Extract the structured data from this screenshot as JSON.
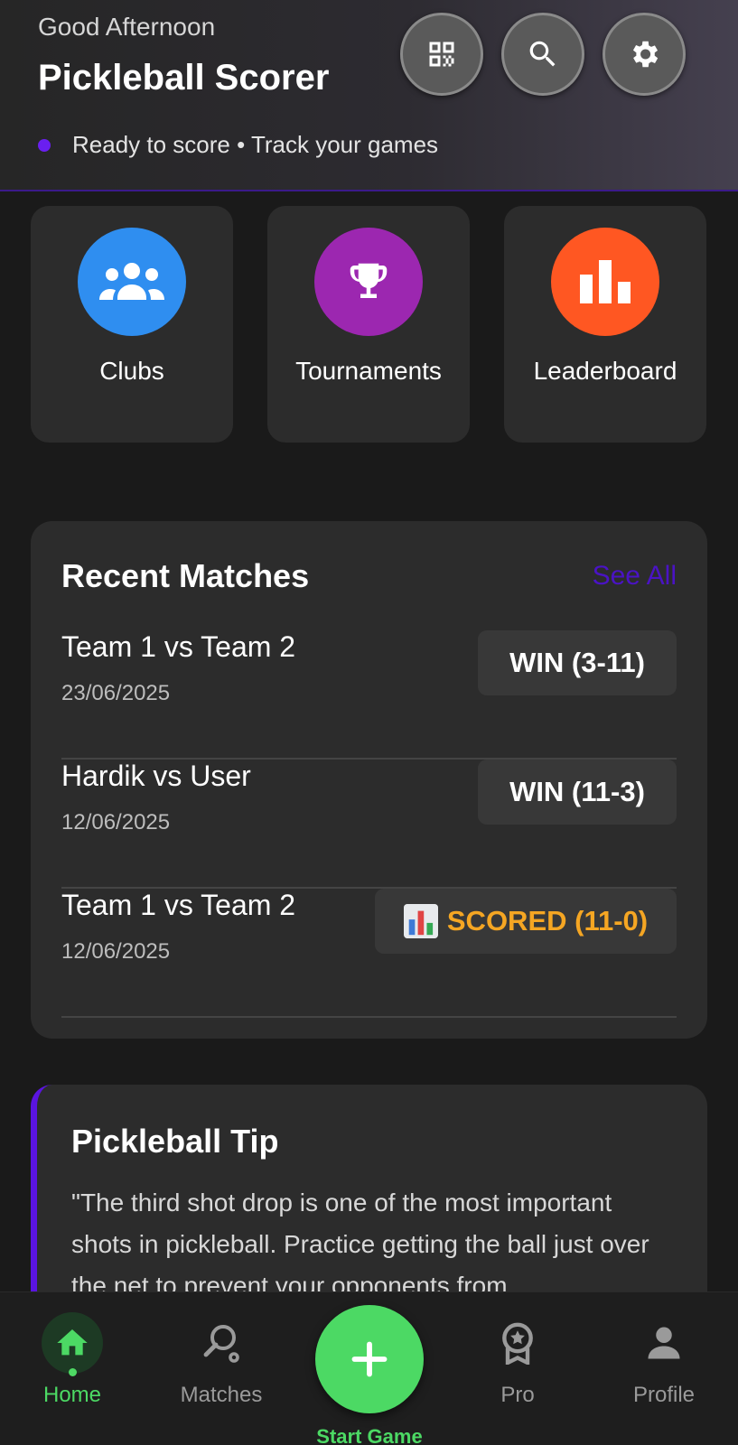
{
  "header": {
    "greeting": "Good Afternoon",
    "title": "Pickleball Scorer",
    "status": "Ready to score • Track your games",
    "status_color": "#6a1ff0",
    "buttons": [
      {
        "icon": "qr-code-icon"
      },
      {
        "icon": "search-icon"
      },
      {
        "icon": "gear-icon"
      }
    ]
  },
  "quick_actions": [
    {
      "label": "Clubs",
      "icon": "group-icon",
      "color": "#2f8ef0"
    },
    {
      "label": "Tournaments",
      "icon": "trophy-icon",
      "color": "#9c27b0"
    },
    {
      "label": "Leaderboard",
      "icon": "bar-chart-icon",
      "color": "#ff5722"
    }
  ],
  "recent_matches": {
    "title": "Recent Matches",
    "see_all": "See All",
    "matches": [
      {
        "name": "Team 1 vs Team 2",
        "date": "23/06/2025",
        "result": "WIN (3-11)",
        "result_color": "#ffffff"
      },
      {
        "name": "Hardik vs User",
        "date": "12/06/2025",
        "result": "WIN (11-3)",
        "result_color": "#ffffff"
      },
      {
        "name": "Team 1 vs Team 2",
        "date": "12/06/2025",
        "result": "SCORED (11-0)",
        "result_icon": "bar-chart-emoji-icon",
        "result_color": "#f5a623"
      }
    ]
  },
  "tip": {
    "title": "Pickleball Tip",
    "text": "\"The third shot drop is one of the most important shots in pickleball. Practice getting the ball just over the net to prevent your opponents from"
  },
  "bottom_nav": {
    "items": [
      {
        "label": "Home",
        "icon": "home-icon",
        "active": true
      },
      {
        "label": "Matches",
        "icon": "paddle-icon",
        "active": false
      },
      {
        "label": "Pro",
        "icon": "award-icon",
        "active": false
      },
      {
        "label": "Profile",
        "icon": "person-icon",
        "active": false
      }
    ],
    "fab_label": "Start Game",
    "active_color": "#4cd964"
  }
}
